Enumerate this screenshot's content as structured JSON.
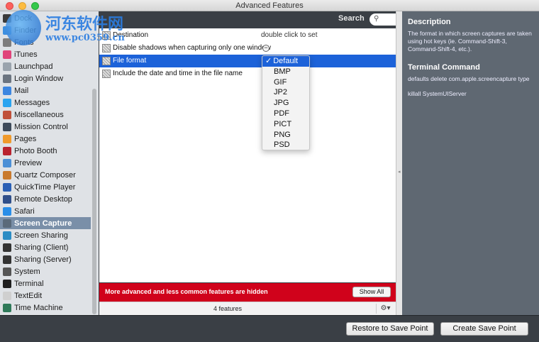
{
  "window": {
    "title": "Advanced Features"
  },
  "watermark": {
    "title": "河东软件网",
    "url": "www.pc0359.cn"
  },
  "sidebar": {
    "items": [
      {
        "label": "Dock",
        "icon": "dock-icon",
        "color": "#3b3b3b"
      },
      {
        "label": "Finder",
        "icon": "finder-icon",
        "color": "#3d8fe0"
      },
      {
        "label": "Fonts",
        "icon": "fonts-icon",
        "color": "#7d7d7d"
      },
      {
        "label": "iTunes",
        "icon": "itunes-icon",
        "color": "#e0447a"
      },
      {
        "label": "Launchpad",
        "icon": "launchpad-icon",
        "color": "#9aa3ad"
      },
      {
        "label": "Login Window",
        "icon": "login-window-icon",
        "color": "#6b7480"
      },
      {
        "label": "Mail",
        "icon": "mail-icon",
        "color": "#3c86e0"
      },
      {
        "label": "Messages",
        "icon": "messages-icon",
        "color": "#2aa4f0"
      },
      {
        "label": "Miscellaneous",
        "icon": "tools-icon",
        "color": "#c0503a"
      },
      {
        "label": "Mission Control",
        "icon": "mission-control-icon",
        "color": "#3e4a5a"
      },
      {
        "label": "Pages",
        "icon": "pages-icon",
        "color": "#f09a2c"
      },
      {
        "label": "Photo Booth",
        "icon": "photo-booth-icon",
        "color": "#b9232f"
      },
      {
        "label": "Preview",
        "icon": "preview-icon",
        "color": "#4b8fd6"
      },
      {
        "label": "Quartz Composer",
        "icon": "quartz-composer-icon",
        "color": "#c97a2e"
      },
      {
        "label": "QuickTime Player",
        "icon": "quicktime-icon",
        "color": "#2a5fb5"
      },
      {
        "label": "Remote Desktop",
        "icon": "remote-desktop-icon",
        "color": "#2f4f8a"
      },
      {
        "label": "Safari",
        "icon": "safari-icon",
        "color": "#2a8ee8"
      },
      {
        "label": "Screen Capture",
        "icon": "screen-capture-icon",
        "color": "#5a6a7a",
        "selected": true
      },
      {
        "label": "Screen Sharing",
        "icon": "screen-sharing-icon",
        "color": "#2b8cc4"
      },
      {
        "label": "Sharing (Client)",
        "icon": "sharing-client-icon",
        "color": "#333333"
      },
      {
        "label": "Sharing (Server)",
        "icon": "sharing-server-icon",
        "color": "#333333"
      },
      {
        "label": "System",
        "icon": "system-icon",
        "color": "#555555"
      },
      {
        "label": "Terminal",
        "icon": "terminal-icon",
        "color": "#1f1f1f"
      },
      {
        "label": "TextEdit",
        "icon": "textedit-icon",
        "color": "#cfcfcf"
      },
      {
        "label": "Time Machine",
        "icon": "time-machine-icon",
        "color": "#2f7a5a"
      }
    ]
  },
  "search": {
    "label": "Search",
    "value": "",
    "icon": "search-icon"
  },
  "list": {
    "rows": [
      {
        "label": "Destination",
        "value": "double click to set"
      },
      {
        "label": "Disable shadows when capturing only one window",
        "value": "−",
        "type": "toggle"
      },
      {
        "label": "File format",
        "value": "",
        "selected": true
      },
      {
        "label": "Include the date and time in the file name",
        "value": ""
      }
    ]
  },
  "dropdown": {
    "selected": "Default",
    "check": "✓",
    "options": [
      "Default",
      "BMP",
      "GIF",
      "JP2",
      "JPG",
      "PDF",
      "PICT",
      "PNG",
      "PSD"
    ]
  },
  "hidden_bar": {
    "message": "More advanced and less common features are hidden",
    "button": "Show All",
    "color": "#d0021b"
  },
  "footer": {
    "count": "4 features",
    "gear": "⚙▾"
  },
  "description": {
    "title": "Description",
    "text": "The format in which screen captures are taken using hot keys (ie. Command-Shift-3, Command-Shift-4, etc.).",
    "terminal_title": "Terminal Command",
    "command": "defaults delete com.apple.screencapture type",
    "command2": "killall SystemUIServer"
  },
  "buttons": {
    "restore": "Restore to Save Point",
    "create": "Create Save Point"
  }
}
